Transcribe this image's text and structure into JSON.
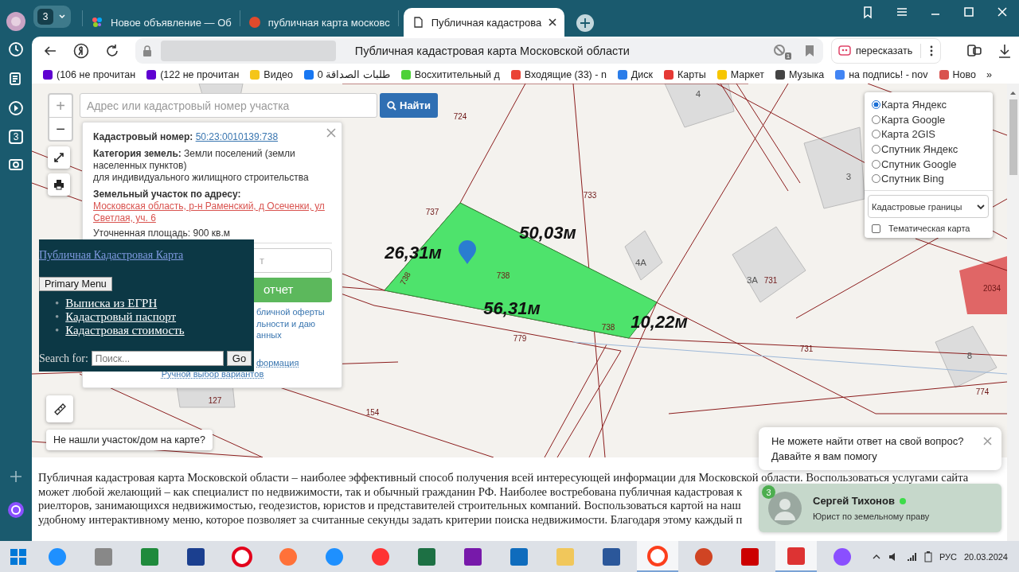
{
  "sidebar": {
    "badge": "3"
  },
  "browser": {
    "profile_count": "3",
    "tabs": [
      {
        "title": "Новое объявление — Об",
        "selected": false,
        "kind": "dots"
      },
      {
        "title": "публичная карта московс",
        "selected": false,
        "kind": "search"
      },
      {
        "title": "Публичная кадастрова",
        "selected": true,
        "kind": "page"
      }
    ],
    "page_title": "Публичная кадастровая карта Московской области",
    "blocked_count": "1",
    "retell_button": "пересказать",
    "bookmarks": [
      {
        "label": "(106 не прочитан",
        "kind": "yahoo"
      },
      {
        "label": "(122 не прочитан",
        "kind": "yahoo"
      },
      {
        "label": "Видео",
        "kind": "video"
      },
      {
        "label": "0 طلبات الصداقة",
        "kind": "facebook"
      },
      {
        "label": "Восхитительный д",
        "kind": "chat"
      },
      {
        "label": "Входящие (33) - n",
        "kind": "gmail"
      },
      {
        "label": "Диск",
        "kind": "disk"
      },
      {
        "label": "Карты",
        "kind": "maps"
      },
      {
        "label": "Маркет",
        "kind": "market"
      },
      {
        "label": "Музыка",
        "kind": "music"
      },
      {
        "label": "на подпись! - nov",
        "kind": "google"
      },
      {
        "label": "Ново",
        "kind": "news"
      }
    ],
    "more_bookmarks": "»"
  },
  "map": {
    "zoom_in": "+",
    "zoom_out": "−",
    "search": {
      "placeholder": "Адрес или кадастровый номер участка",
      "button": "Найти"
    },
    "labels": [
      {
        "text": "724",
        "kind": "parcel"
      },
      {
        "text": "4",
        "kind": "house"
      },
      {
        "text": "733",
        "kind": "parcel"
      },
      {
        "text": "3",
        "kind": "house"
      },
      {
        "text": "737",
        "kind": "parcel"
      },
      {
        "text": "738",
        "kind": "parcel"
      },
      {
        "text": "738",
        "kind": "parcel"
      },
      {
        "text": "738",
        "kind": "parcel"
      },
      {
        "text": "4А",
        "kind": "house"
      },
      {
        "text": "3А",
        "kind": "house"
      },
      {
        "text": "731",
        "kind": "parcel"
      },
      {
        "text": "2034",
        "kind": "parcel"
      },
      {
        "text": "779",
        "kind": "parcel"
      },
      {
        "text": "731",
        "kind": "parcel"
      },
      {
        "text": "8",
        "kind": "house"
      },
      {
        "text": "774",
        "kind": "parcel"
      },
      {
        "text": "127",
        "kind": "parcel"
      },
      {
        "text": "154",
        "kind": "parcel"
      },
      {
        "text": "50,03м",
        "kind": "dimension"
      },
      {
        "text": "26,31м",
        "kind": "dimension"
      },
      {
        "text": "56,31м",
        "kind": "dimension"
      },
      {
        "text": "10,22м",
        "kind": "dimension"
      }
    ],
    "popup": {
      "cadastral_label": "Кадастровый номер:",
      "cadastral_number": "50:23:0010139:738",
      "category": "**Категория земель:** Земли поселений (земли населенных пунктов)",
      "usage": "для индивидуального жилищного строительства",
      "address_label": "Земельный участок по адресу:",
      "address": "Московская область, р-н Раменский, д Осеченки, ул Светлая, уч. 6",
      "area": "Уточненная площадь: 900 кв.м",
      "field_placeholder": "т",
      "report_button": "отчет",
      "terms": [
        "бличной оферты",
        "льности и даю",
        "анных"
      ],
      "info_link": "формация",
      "manual_link": "Ручной выбор вариантов"
    },
    "site_menu": {
      "title_link": "Публичная Кадастровая Карта",
      "menu_button": "Primary Menu",
      "bullet": "•",
      "items": [
        "Выписка из ЕГРН",
        "Кадастровый паспорт",
        "Кадастровая стоимость"
      ],
      "search_label": "Search for:",
      "search_placeholder": "Поиск...",
      "go_button": "Go"
    },
    "layers": {
      "options": [
        {
          "label": "Карта Яндекс",
          "selected": true
        },
        {
          "label": "Карта Google",
          "selected": false
        },
        {
          "label": "Карта 2GIS",
          "selected": false
        },
        {
          "label": "Спутник Яндекс",
          "selected": false
        },
        {
          "label": "Спутник Google",
          "selected": false
        },
        {
          "label": "Спутник Bing",
          "selected": false
        }
      ],
      "overlay_select": "Кадастровые границы",
      "thematic": {
        "label": "Тематическая карта",
        "checked": false
      }
    },
    "not_found_button": "Не нашли участок/дом на карте?"
  },
  "article": {
    "lines": [
      "Публичная кадастровая карта Московской области – наиболее эффективный способ получения всей интересующей информации для Московской области. Воспользоваться услугами сайта",
      "может любой желающий – как специалист по недвижимости, так и обычный гражданин РФ. Наиболее востребована публичная кадастровая к",
      "риелторов, занимающихся недвижимостью, геодезистов, юристов и представителей строительных компаний. Воспользоваться картой на наш",
      "удобному интерактивному меню, которое позволяет за считанные секунды задать критерии поиска недвижимости. Благодаря этому каждый п"
    ]
  },
  "chat": {
    "message": [
      "Не можете найти ответ на свой вопрос?",
      "Давайте я вам помогу"
    ],
    "badge": "3",
    "name": "Сергей Тихонов",
    "online": true,
    "role": "Юрист по земельному праву"
  },
  "taskbar": {
    "apps": [
      {
        "kind": "ie",
        "selected": false
      },
      {
        "kind": "printer",
        "selected": false
      },
      {
        "kind": "store",
        "selected": false
      },
      {
        "kind": "help",
        "selected": false
      },
      {
        "kind": "opera",
        "selected": false
      },
      {
        "kind": "firefox",
        "selected": false
      },
      {
        "kind": "ie",
        "selected": false
      },
      {
        "kind": "yandex",
        "selected": false
      },
      {
        "kind": "excel",
        "selected": false
      },
      {
        "kind": "onenote",
        "selected": false
      },
      {
        "kind": "outlook",
        "selected": false
      },
      {
        "kind": "folder",
        "selected": false
      },
      {
        "kind": "word",
        "selected": false
      },
      {
        "kind": "browser",
        "selected": true
      },
      {
        "kind": "powerpoint",
        "selected": false
      },
      {
        "kind": "pdf",
        "selected": false
      },
      {
        "kind": "cleaner",
        "selected": true
      },
      {
        "kind": "alice",
        "selected": false
      }
    ],
    "language": "РУС",
    "date": "20.03.2024"
  }
}
